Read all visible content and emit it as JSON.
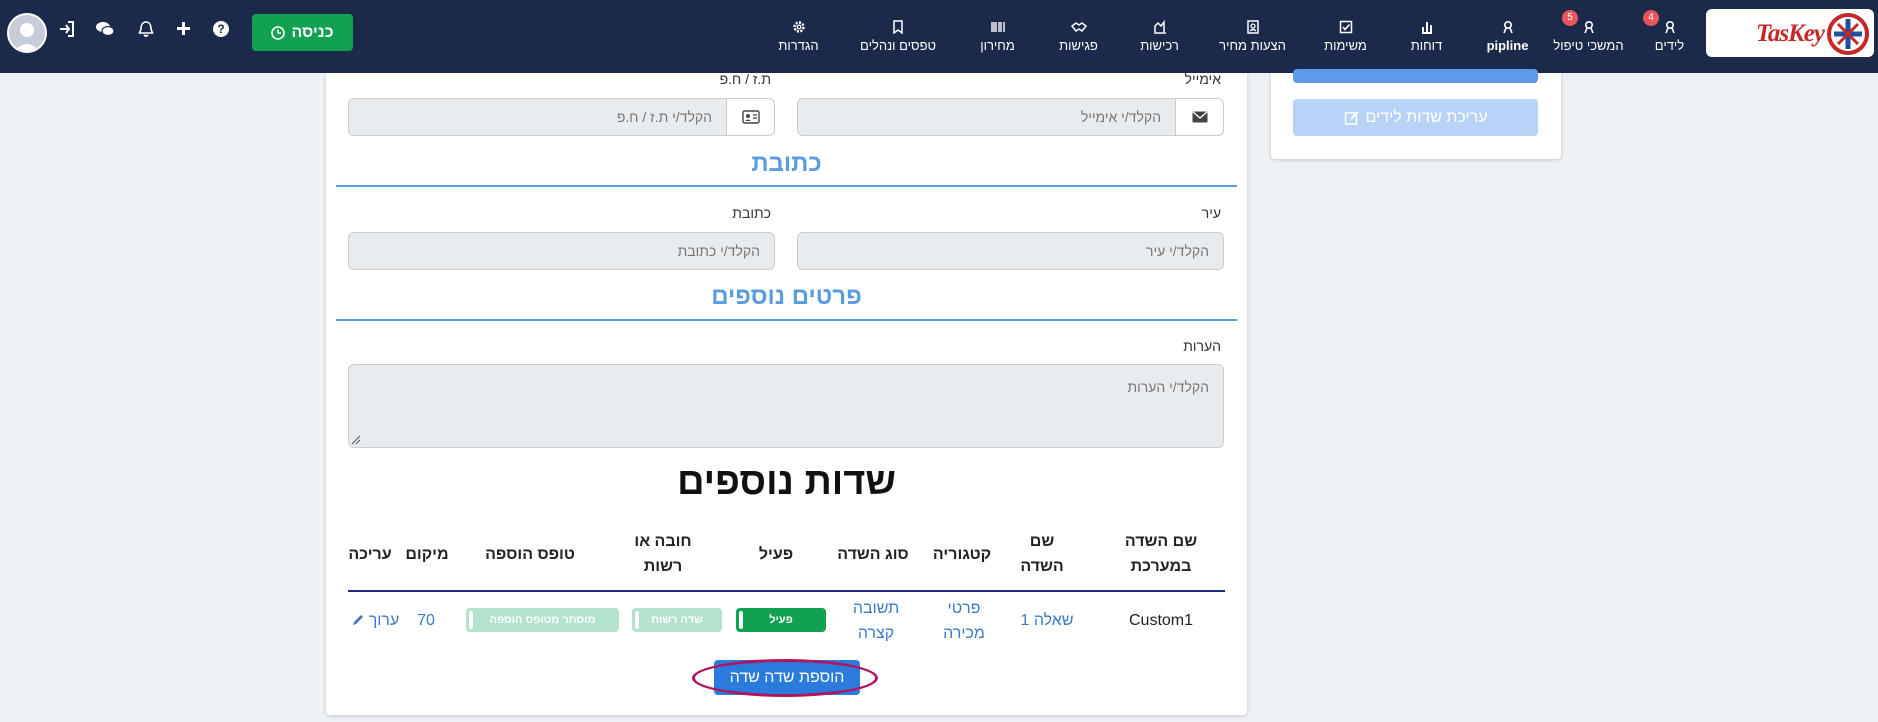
{
  "brand": {
    "name": "TasKey",
    "colors": {
      "navbar": "#1b2a4a",
      "accent": "#2a7bdb",
      "success": "#12a150",
      "section": "#5b9ce0"
    }
  },
  "nav": {
    "items": [
      {
        "label": "לידים",
        "icon": "leads-icon",
        "badge": "4"
      },
      {
        "label": "המשכי טיפול",
        "icon": "followup-icon",
        "badge": "5"
      },
      {
        "label": "pipline",
        "icon": "pipeline-icon"
      },
      {
        "label": "דוחות",
        "icon": "reports-icon"
      },
      {
        "label": "משימות",
        "icon": "tasks-icon"
      },
      {
        "label": "הצעות מחיר",
        "icon": "quotes-icon"
      },
      {
        "label": "רכישות",
        "icon": "purchases-icon"
      },
      {
        "label": "פגישות",
        "icon": "meetings-icon"
      },
      {
        "label": "מחירון",
        "icon": "pricelist-icon"
      },
      {
        "label": "טפסים ונהלים",
        "icon": "forms-icon"
      },
      {
        "label": "הגדרות",
        "icon": "settings-icon"
      }
    ],
    "entry_button": "כניסה",
    "left_icons": [
      "login-icon",
      "chat-icon",
      "bell-icon",
      "plus-icon",
      "help-icon"
    ]
  },
  "side_panel": {
    "edit_fields_button": "עריכת שדות לידים"
  },
  "form": {
    "email": {
      "label": "אימייל",
      "placeholder": "הקלד/י אימייל"
    },
    "id_number": {
      "label": "ת.ז / ח.פ",
      "placeholder": "הקלד/י ת.ז / ח.פ"
    },
    "address_section": "כתובת",
    "city": {
      "label": "עיר",
      "placeholder": "הקלד/י עיר"
    },
    "address": {
      "label": "כתובת",
      "placeholder": "הקלד/י כתובת"
    },
    "more_section": "פרטים נוספים",
    "notes": {
      "label": "הערות",
      "placeholder": "הקלד/י הערות"
    }
  },
  "extra_fields": {
    "title": "שדות נוספים",
    "headers": [
      "שם השדה במערכת",
      "שם השדה",
      "קטגוריה",
      "סוג השדה",
      "פעיל",
      "חובה או רשות",
      "טופס הוספה",
      "מיקום",
      "עריכה"
    ],
    "rows": [
      {
        "system_name": "Custom1",
        "field_name": "שאלה 1",
        "category": "פרטי מכירה",
        "field_type": "תשובה קצרה",
        "active": "פעיל",
        "required": "שדה רשות",
        "add_form": "מוסתר מטופס הוספה",
        "position": "70",
        "edit": "ערוך"
      }
    ],
    "add_button": "הוספת שדה שדה"
  }
}
